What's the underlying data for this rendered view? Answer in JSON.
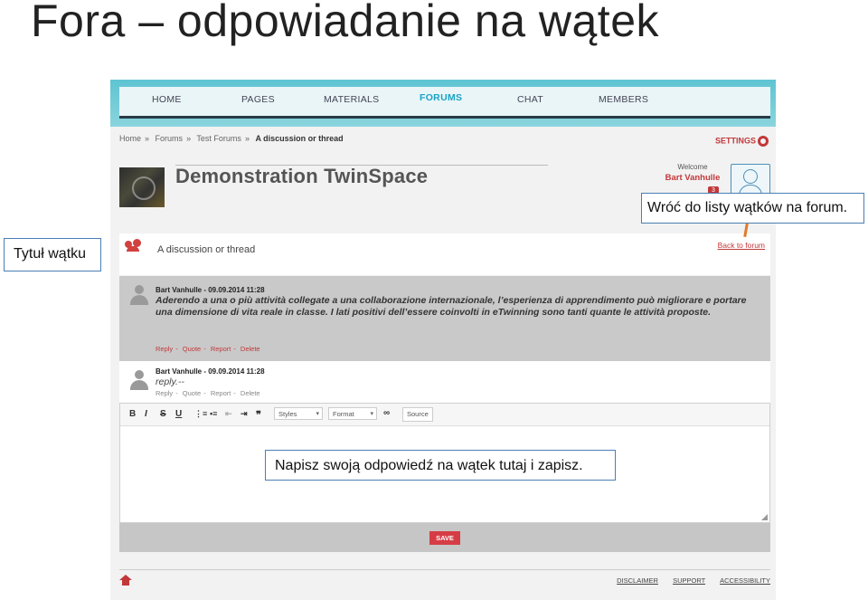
{
  "slide": {
    "title": "Fora – odpowiadanie na wątek"
  },
  "nav": {
    "items": [
      "HOME",
      "PAGES",
      "MATERIALS",
      "FORUMS",
      "CHAT",
      "MEMBERS"
    ],
    "active": "FORUMS"
  },
  "breadcrumb": [
    "Home",
    "Forums",
    "Test Forums",
    "A discussion or thread"
  ],
  "header": {
    "settings_label": "SETTINGS",
    "space_title": "Demonstration TwinSpace",
    "welcome_label": "Welcome",
    "user_name": "Bart Vanhulle",
    "badge_count": "3"
  },
  "thread": {
    "title": "A discussion or thread",
    "back_link": "Back to forum"
  },
  "posts": [
    {
      "author": "Bart Vanhulle - 09.09.2014 11:28",
      "text": "Aderendo a una o più attività collegate a una collaborazione internazionale, l’esperienza di apprendimento può migliorare e portare una dimensione di vita reale in classe. I lati positivi dell’essere coinvolti in eTwinning sono tanti quante le attività proposte.",
      "actions": [
        "Reply",
        "Quote",
        "Report",
        "Delete"
      ]
    },
    {
      "author": "Bart Vanhulle - 09.09.2014 11:28",
      "text": "reply.--",
      "actions": [
        "Reply",
        "Quote",
        "Report",
        "Delete"
      ]
    }
  ],
  "editor": {
    "toolbar": {
      "bold": "B",
      "italic": "I",
      "strike": "S",
      "underline": "U",
      "styles": "Styles",
      "format": "Format",
      "source": "Source"
    }
  },
  "save_label": "SAVE",
  "footer": {
    "links": [
      "DISCLAIMER",
      "SUPPORT",
      "ACCESSIBILITY"
    ]
  },
  "callouts": {
    "back": "Wróć do listy wątków na forum.",
    "title": "Tytuł wątku",
    "write": "Napisz swoją odpowiedź na wątek tutaj i zapisz."
  },
  "colors": {
    "accent": "#c2383a",
    "nav_active": "#1aa3c5",
    "topbar": "#5fc4d2",
    "callout_border": "#4a7fb5"
  }
}
